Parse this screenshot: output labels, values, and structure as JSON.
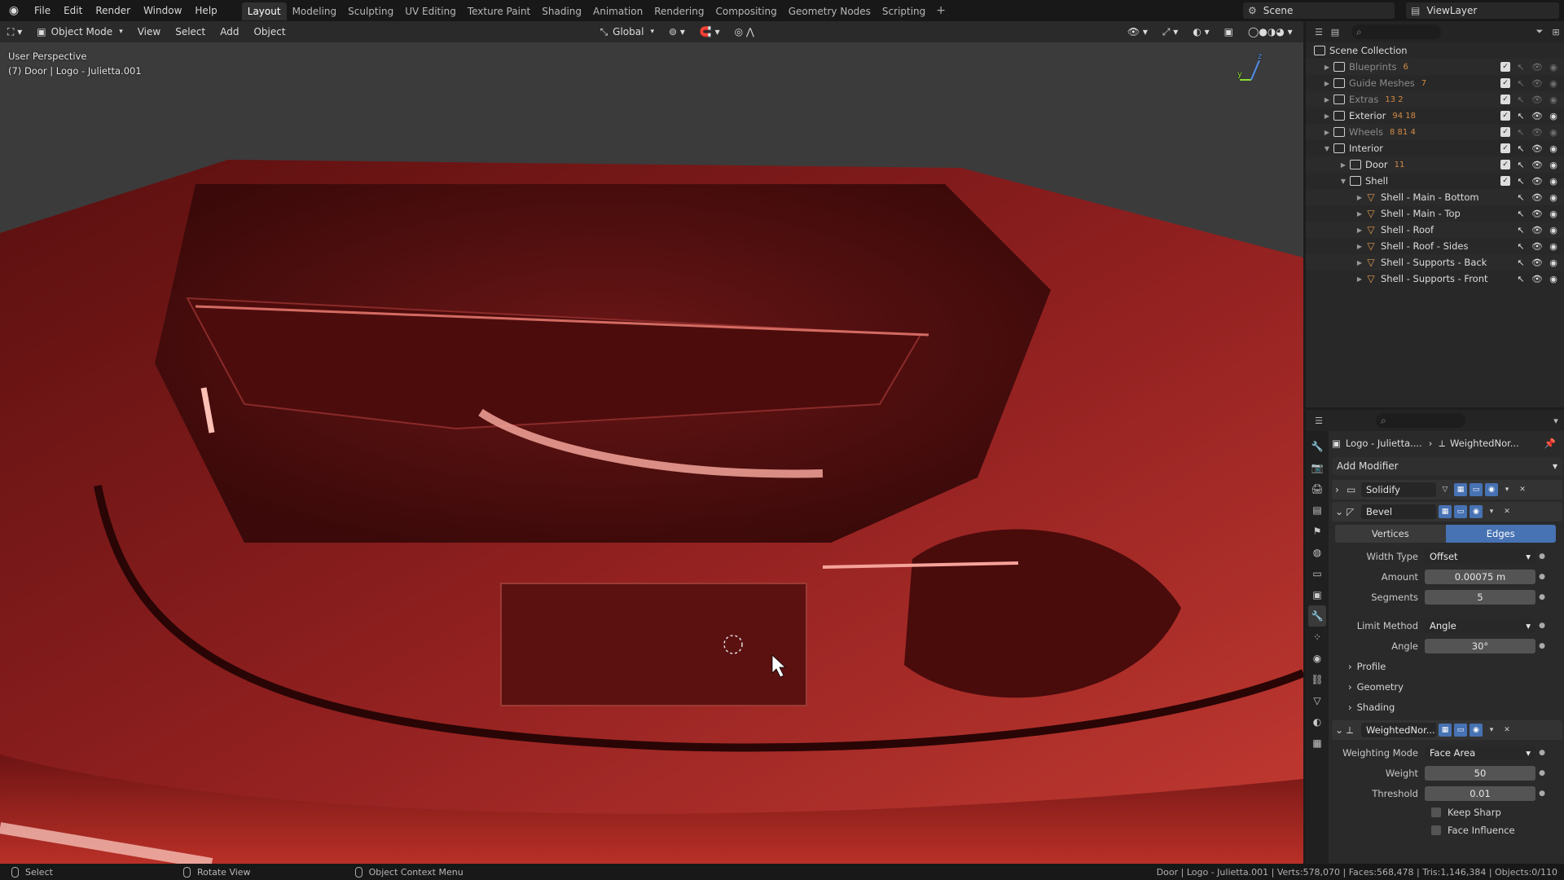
{
  "topbar": {
    "menus": [
      "File",
      "Edit",
      "Render",
      "Window",
      "Help"
    ],
    "workspaces": [
      "Layout",
      "Modeling",
      "Sculpting",
      "UV Editing",
      "Texture Paint",
      "Shading",
      "Animation",
      "Rendering",
      "Compositing",
      "Geometry Nodes",
      "Scripting"
    ],
    "active_workspace": "Layout",
    "add_tab": "+",
    "scene": "Scene",
    "view_layer": "ViewLayer"
  },
  "viewport_header": {
    "mode": "Object Mode",
    "menus": [
      "View",
      "Select",
      "Add",
      "Object"
    ],
    "transform": "Global"
  },
  "viewport": {
    "perspective": "User Perspective",
    "object": "(7) Door | Logo - Julietta.001",
    "gizmo_y": "y",
    "gizmo_z": "z",
    "colors": {
      "body": "#8e1f1f",
      "highlight": "#f08a80",
      "shadow": "#3a0707"
    }
  },
  "outliner": {
    "root": "Scene Collection",
    "rows": [
      {
        "label": "Blueprints",
        "level": 1,
        "type": "collection",
        "badge": "6",
        "dim": true
      },
      {
        "label": "Guide Meshes",
        "level": 1,
        "type": "collection",
        "badge": "7",
        "dim": true
      },
      {
        "label": "Extras",
        "level": 1,
        "type": "collection",
        "badge": "13 2",
        "dim": true
      },
      {
        "label": "Exterior",
        "level": 1,
        "type": "collection",
        "badge": "94 18",
        "dim": false
      },
      {
        "label": "Wheels",
        "level": 1,
        "type": "collection",
        "badge": "8 81 4",
        "dim": true
      },
      {
        "label": "Interior",
        "level": 1,
        "type": "collection",
        "badge": "",
        "dim": false,
        "open": true
      },
      {
        "label": "Door",
        "level": 2,
        "type": "collection",
        "badge": "11",
        "dim": false
      },
      {
        "label": "Shell",
        "level": 2,
        "type": "collection",
        "badge": "",
        "dim": false,
        "open": true
      },
      {
        "label": "Shell - Main - Bottom",
        "level": 3,
        "type": "mesh",
        "badge": "",
        "dim": false
      },
      {
        "label": "Shell - Main - Top",
        "level": 3,
        "type": "mesh",
        "badge": "",
        "dim": false
      },
      {
        "label": "Shell - Roof",
        "level": 3,
        "type": "mesh",
        "badge": "",
        "dim": false
      },
      {
        "label": "Shell - Roof - Sides",
        "level": 3,
        "type": "mesh",
        "badge": "",
        "dim": false
      },
      {
        "label": "Shell - Supports - Back",
        "level": 3,
        "type": "mesh",
        "badge": "",
        "dim": false
      },
      {
        "label": "Shell - Supports - Front",
        "level": 3,
        "type": "mesh",
        "badge": "",
        "dim": false
      }
    ]
  },
  "properties": {
    "breadcrumb_object": "Logo - Julietta....",
    "breadcrumb_modifier": "WeightedNor...",
    "add_modifier": "Add Modifier",
    "solidify": {
      "name": "Solidify"
    },
    "bevel": {
      "name": "Bevel",
      "affect_vertices": "Vertices",
      "affect_edges": "Edges",
      "width_type_label": "Width Type",
      "width_type": "Offset",
      "amount_label": "Amount",
      "amount": "0.00075 m",
      "segments_label": "Segments",
      "segments": "5",
      "limit_method_label": "Limit Method",
      "limit_method": "Angle",
      "angle_label": "Angle",
      "angle": "30°",
      "profile": "Profile",
      "geometry": "Geometry",
      "shading": "Shading"
    },
    "weighted": {
      "name": "WeightedNor...",
      "mode_label": "Weighting Mode",
      "mode": "Face Area",
      "weight_label": "Weight",
      "weight": "50",
      "threshold_label": "Threshold",
      "threshold": "0.01",
      "keep_sharp": "Keep Sharp",
      "face_influence": "Face Influence"
    }
  },
  "status": {
    "select": "Select",
    "rotate": "Rotate View",
    "context": "Object Context Menu",
    "stats": "Door | Logo - Julietta.001 | Verts:578,070 | Faces:568,478 | Tris:1,146,384 | Objects:0/110"
  }
}
